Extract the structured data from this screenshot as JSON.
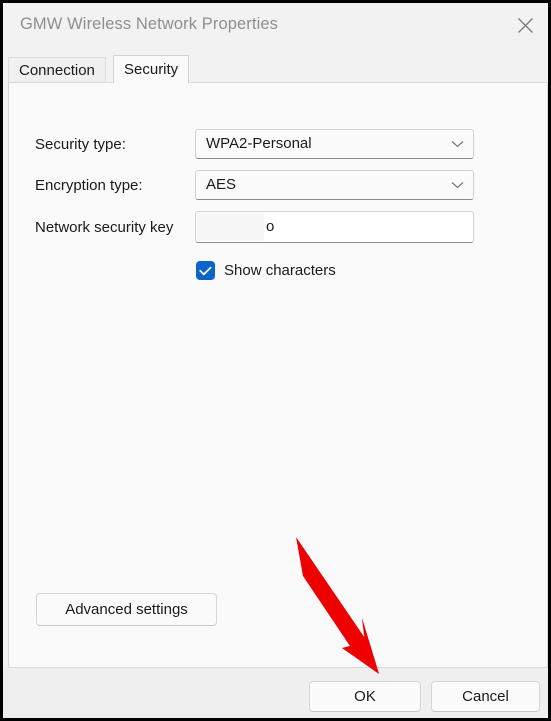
{
  "window": {
    "title": "GMW Wireless Network Properties",
    "close_icon": "close-x-icon"
  },
  "tabs": [
    {
      "label": "Connection",
      "selected": false
    },
    {
      "label": "Security",
      "selected": true
    }
  ],
  "security_tab": {
    "security_type": {
      "label": "Security type:",
      "value": "WPA2-Personal",
      "chevron_icon": "chevron-down-icon"
    },
    "encryption_type": {
      "label": "Encryption type:",
      "value": "AES",
      "chevron_icon": "chevron-down-icon"
    },
    "network_security_key": {
      "label": "Network security key",
      "value": "o",
      "redacted": true
    },
    "show_characters": {
      "label": "Show characters",
      "checked": true,
      "check_icon": "checkmark-icon"
    },
    "advanced_settings_label": "Advanced settings"
  },
  "footer": {
    "ok_label": "OK",
    "cancel_label": "Cancel"
  },
  "annotation": {
    "arrow_color": "#EE0000",
    "points_to": "OK"
  },
  "colors": {
    "accent": "#0C64C8",
    "title_text": "#8F8F8F",
    "panel_bg": "#FAFAFA",
    "dialog_bg": "#F2F2F2",
    "footer_bg": "#EFEFEF"
  }
}
